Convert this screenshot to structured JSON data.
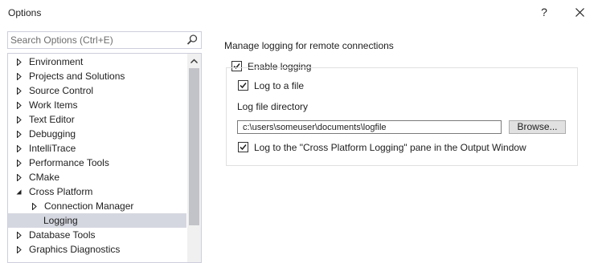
{
  "window": {
    "title": "Options",
    "help_label": "?"
  },
  "search": {
    "placeholder": "Search Options (Ctrl+E)"
  },
  "tree": {
    "items": [
      {
        "label": "Environment",
        "expander": "collapsed"
      },
      {
        "label": "Projects and Solutions",
        "expander": "collapsed"
      },
      {
        "label": "Source Control",
        "expander": "collapsed"
      },
      {
        "label": "Work Items",
        "expander": "collapsed"
      },
      {
        "label": "Text Editor",
        "expander": "collapsed"
      },
      {
        "label": "Debugging",
        "expander": "collapsed"
      },
      {
        "label": "IntelliTrace",
        "expander": "collapsed"
      },
      {
        "label": "Performance Tools",
        "expander": "collapsed"
      },
      {
        "label": "CMake",
        "expander": "collapsed"
      },
      {
        "label": "Cross Platform",
        "expander": "expanded"
      },
      {
        "label": "Connection Manager",
        "expander": "collapsed"
      },
      {
        "label": "Logging",
        "expander": "none",
        "selected": true
      },
      {
        "label": "Database Tools",
        "expander": "collapsed"
      },
      {
        "label": "Graphics Diagnostics",
        "expander": "collapsed"
      }
    ]
  },
  "panel": {
    "title": "Manage logging for remote connections",
    "enable_logging": {
      "label": "Enable logging",
      "checked": true
    },
    "log_to_file": {
      "label": "Log to a file",
      "checked": true
    },
    "log_dir_label": "Log file directory",
    "log_dir_value": "c:\\users\\someuser\\documents\\logfile",
    "browse_label": "Browse...",
    "log_to_pane": {
      "label": "Log to the \"Cross Platform Logging\" pane in the Output Window",
      "checked": true
    }
  },
  "colors": {
    "selection": "#d5d7e0",
    "border": "#cccedb",
    "scroll_thumb": "#c2c3c9"
  }
}
